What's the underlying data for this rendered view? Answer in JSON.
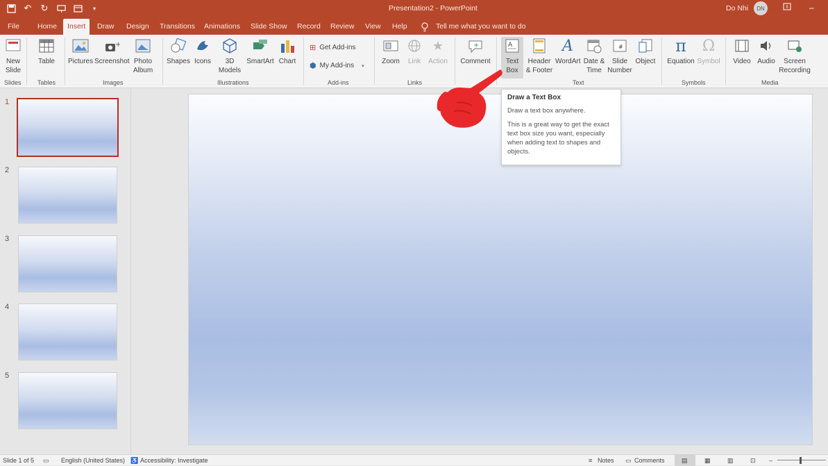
{
  "titlebar": {
    "title": "Presentation2  -  PowerPoint",
    "user": "Do Nhi",
    "initials": "DN"
  },
  "qat": [
    "save-icon",
    "undo-icon",
    "redo-icon",
    "present-icon",
    "layout-icon",
    "customize-icon"
  ],
  "tabs": [
    {
      "label": "File"
    },
    {
      "label": "Home"
    },
    {
      "label": "Insert"
    },
    {
      "label": "Draw"
    },
    {
      "label": "Design"
    },
    {
      "label": "Transitions"
    },
    {
      "label": "Animations"
    },
    {
      "label": "Slide Show"
    },
    {
      "label": "Record"
    },
    {
      "label": "Review"
    },
    {
      "label": "View"
    },
    {
      "label": "Help"
    }
  ],
  "search": {
    "label": "Tell me what you want to do"
  },
  "ribbon": {
    "new_slide": {
      "l1": "New",
      "l2": "Slide"
    },
    "table": {
      "l1": "Table"
    },
    "pictures": {
      "l1": "Pictures"
    },
    "screenshot": {
      "l1": "Screenshot"
    },
    "photo_album": {
      "l1": "Photo",
      "l2": "Album"
    },
    "shapes": {
      "l1": "Shapes"
    },
    "icons": {
      "l1": "Icons"
    },
    "models3d": {
      "l1": "3D",
      "l2": "Models"
    },
    "smartart": {
      "l1": "SmartArt"
    },
    "chart": {
      "l1": "Chart"
    },
    "get_addins": {
      "l1": "Get Add-ins"
    },
    "my_addins": {
      "l1": "My Add-ins"
    },
    "zoom": {
      "l1": "Zoom"
    },
    "link": {
      "l1": "Link"
    },
    "action": {
      "l1": "Action"
    },
    "comment": {
      "l1": "Comment"
    },
    "text_box": {
      "l1": "Text",
      "l2": "Box"
    },
    "header_footer": {
      "l1": "Header",
      "l2": "& Footer"
    },
    "wordart": {
      "l1": "WordArt"
    },
    "date_time": {
      "l1": "Date &",
      "l2": "Time"
    },
    "slide_number": {
      "l1": "Slide",
      "l2": "Number"
    },
    "object": {
      "l1": "Object"
    },
    "equation": {
      "l1": "Equation"
    },
    "symbol": {
      "l1": "Symbol"
    },
    "video": {
      "l1": "Video"
    },
    "audio": {
      "l1": "Audio"
    },
    "screen_recording": {
      "l1": "Screen",
      "l2": "Recording"
    },
    "groups": {
      "slides": "Slides",
      "tables": "Tables",
      "images": "Images",
      "illustrations": "Illustrations",
      "addins": "Add-ins",
      "links": "Links",
      "text": "Text",
      "symbols": "Symbols",
      "media": "Media"
    }
  },
  "tooltip": {
    "title": "Draw a Text Box",
    "line1": "Draw a text box anywhere.",
    "line2": "This is a great way to get the exact text box size you want, especially when adding text to shapes and objects."
  },
  "slides": [
    {
      "num": "1"
    },
    {
      "num": "2"
    },
    {
      "num": "3"
    },
    {
      "num": "4"
    },
    {
      "num": "5"
    }
  ],
  "status": {
    "slide": "Slide 1 of 5",
    "language": "English (United States)",
    "accessibility": "Accessibility: Investigate",
    "notes": "Notes",
    "comments": "Comments"
  },
  "colors": {
    "accent": "#b7472a",
    "ribbon": "#f3f3f3",
    "selected_slide_border": "#b2302a",
    "pointer": "#e8282b"
  }
}
